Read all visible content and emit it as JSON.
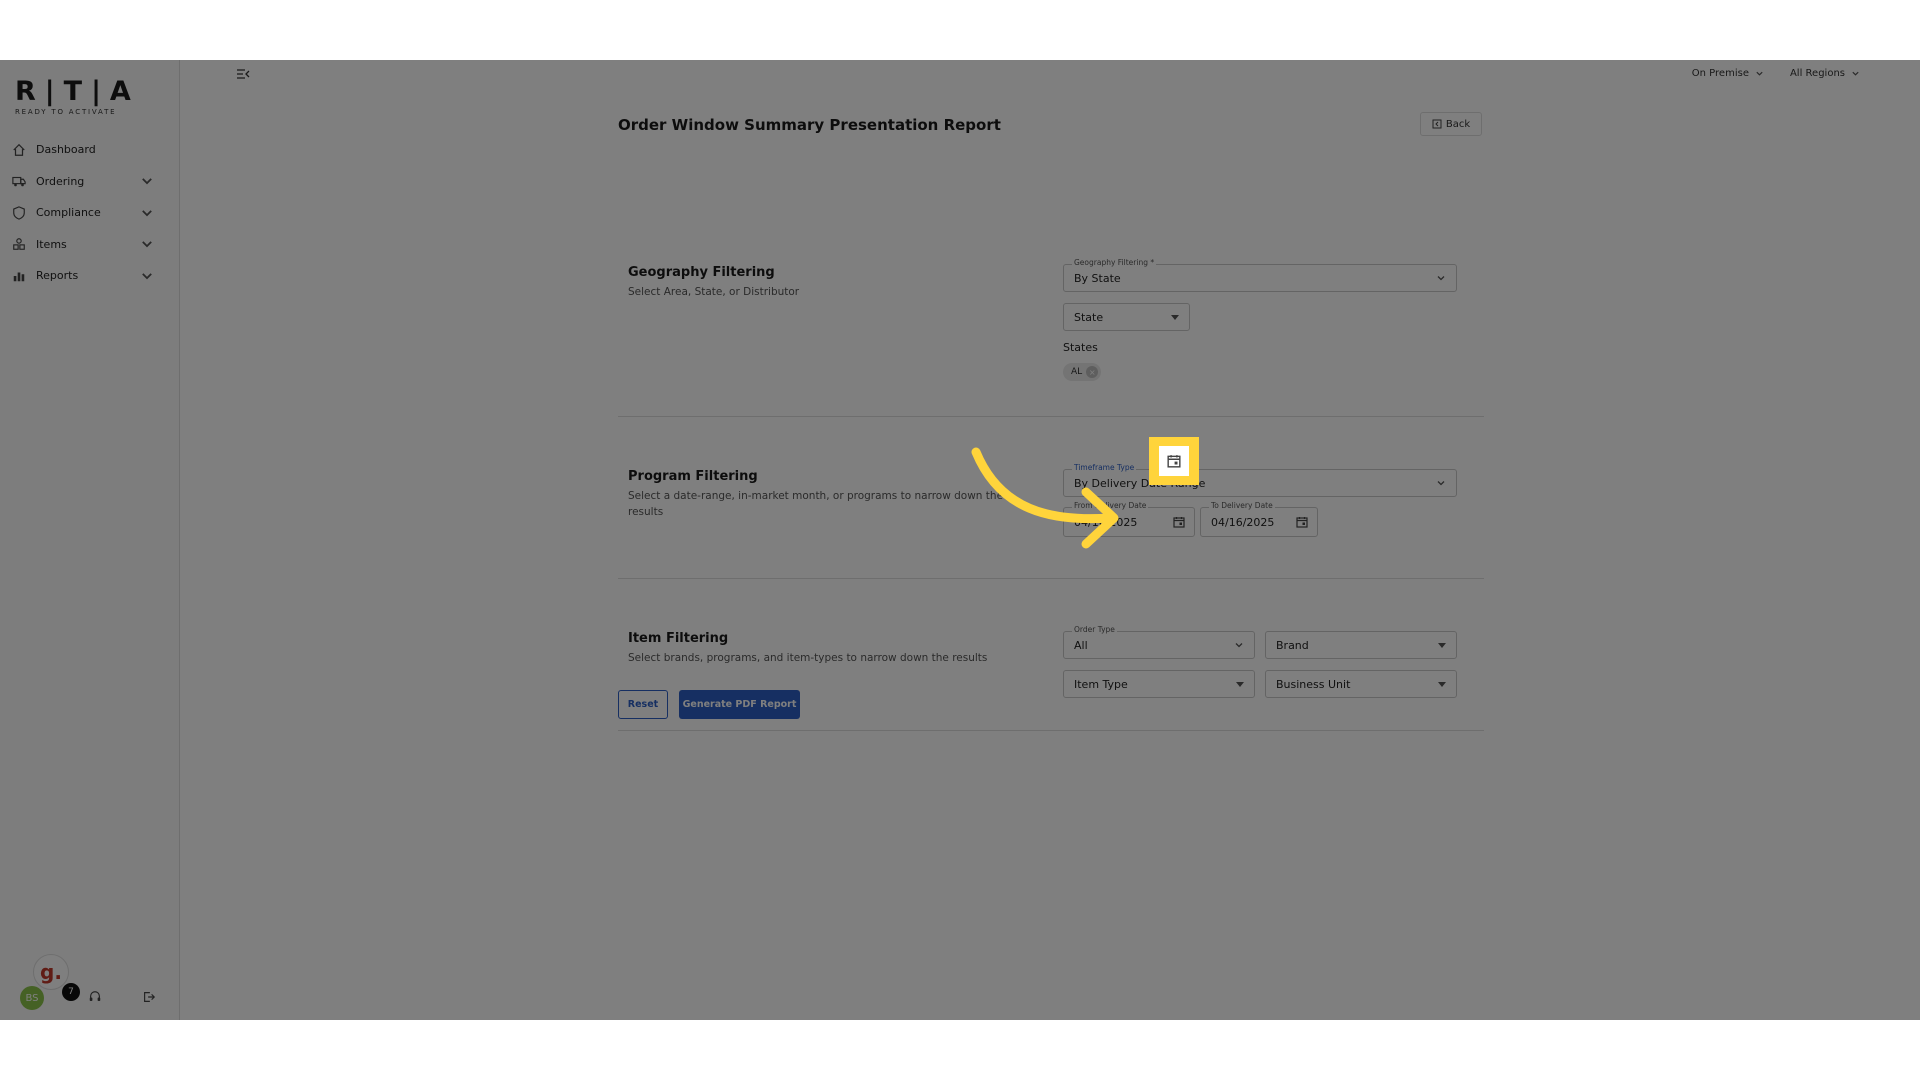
{
  "app": {
    "logo_text": "R|T|A",
    "logo_tagline": "READY TO ACTIVATE"
  },
  "sidebar": {
    "items": [
      {
        "label": "Dashboard",
        "icon": "home-icon",
        "expandable": false
      },
      {
        "label": "Ordering",
        "icon": "truck-icon",
        "expandable": true
      },
      {
        "label": "Compliance",
        "icon": "shield-icon",
        "expandable": true
      },
      {
        "label": "Items",
        "icon": "items-icon",
        "expandable": true
      },
      {
        "label": "Reports",
        "icon": "bar-chart-icon",
        "expandable": true
      }
    ],
    "user_initials": "BS",
    "notification_count": "7",
    "g_badge": "g."
  },
  "topbar": {
    "deployment": "On Premise",
    "region": "All Regions"
  },
  "page": {
    "title": "Order Window Summary Presentation Report",
    "back_label": "Back"
  },
  "geography": {
    "title": "Geography Filtering",
    "description": "Select Area, State, or Distributor",
    "filter_label": "Geography Filtering *",
    "filter_value": "By State",
    "level_value": "State",
    "states_label": "States",
    "states": [
      "AL"
    ]
  },
  "program": {
    "title": "Program Filtering",
    "description": "Select a date-range, in-market month, or programs to narrow down the results",
    "timeframe_label": "Timeframe Type",
    "timeframe_value": "By Delivery Date Range",
    "from_label": "From Delivery Date",
    "from_value": "04/16/2025",
    "to_label": "To Delivery Date",
    "to_value": "04/16/2025"
  },
  "item": {
    "title": "Item Filtering",
    "description": "Select brands, programs, and item-types to narrow down the results",
    "order_type_label": "Order Type",
    "order_type_value": "All",
    "brand_placeholder": "Brand",
    "item_type_placeholder": "Item Type",
    "business_unit_placeholder": "Business Unit"
  },
  "actions": {
    "reset_label": "Reset",
    "generate_label": "Generate PDF Report"
  },
  "colors": {
    "primary": "#2d5fc4",
    "highlight": "#ffd43b",
    "overlay": "rgba(0,0,0,0.5)"
  }
}
